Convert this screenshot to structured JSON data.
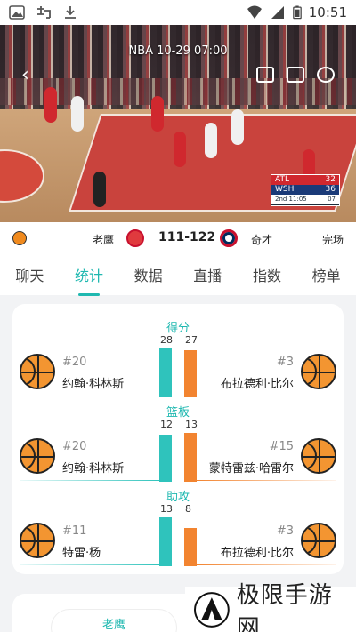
{
  "statusbar": {
    "time": "10:51"
  },
  "video": {
    "title": "NBA  10-29 07:00",
    "scorebug": {
      "team1": "ATL",
      "score1": "32",
      "team2": "WSH",
      "score2": "36",
      "clock": "2nd 11:05",
      "shot": "07"
    }
  },
  "match": {
    "home_team": "老鹰",
    "score": "111-122",
    "away_team": "奇才",
    "status": "完场"
  },
  "tabs": [
    "聊天",
    "统计",
    "数据",
    "直播",
    "指数",
    "榜单"
  ],
  "stats": [
    {
      "title": "得分",
      "left_value": "28",
      "right_value": "27",
      "left_number": "#20",
      "left_name": "约翰·科林斯",
      "right_number": "#3",
      "right_name": "布拉德利·比尔"
    },
    {
      "title": "篮板",
      "left_value": "12",
      "right_value": "13",
      "left_number": "#20",
      "left_name": "约翰·科林斯",
      "right_number": "#15",
      "right_name": "蒙特雷兹·哈雷尔"
    },
    {
      "title": "助攻",
      "left_value": "13",
      "right_value": "8",
      "left_number": "#11",
      "left_name": "特雷·杨",
      "right_number": "#3",
      "right_name": "布拉德利·比尔"
    }
  ],
  "bottom": {
    "team_pill": "老鹰"
  },
  "watermark": {
    "text": "极限手游网"
  },
  "colors": {
    "accent": "#1fb8b0",
    "home_bar": "#2fc3bc",
    "away_bar": "#f28430"
  }
}
